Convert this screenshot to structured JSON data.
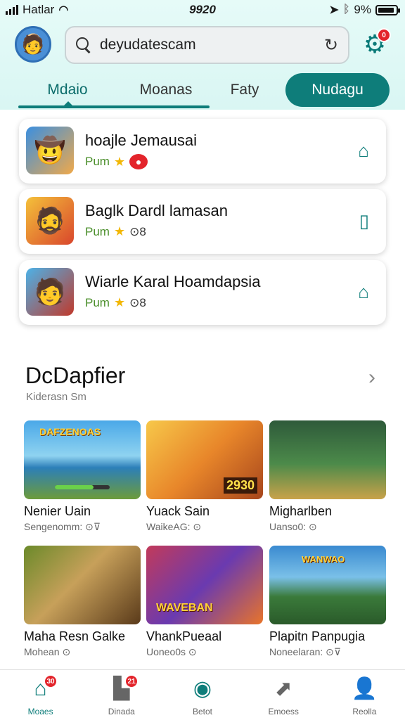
{
  "status_bar": {
    "carrier": "Hatlar",
    "time": "9920",
    "battery": "9%",
    "battery_level": 0.9
  },
  "search": {
    "value": "deyudatescam"
  },
  "settings": {
    "badge": "0"
  },
  "tabs": [
    {
      "label": "Mdaio"
    },
    {
      "label": "Moanas"
    },
    {
      "label": "Faty"
    },
    {
      "label": "Nudagu"
    }
  ],
  "featured": [
    {
      "title": "hoajle Jemausai",
      "meta": "Pum"
    },
    {
      "title": "Baglk Dardl lamasan",
      "meta": "Pum",
      "extra": "⊙8"
    },
    {
      "title": "Wiarle Karal Hoamdapsia",
      "meta": "Pum",
      "extra": "⊙8"
    }
  ],
  "section": {
    "title": "DcDapfier",
    "subtitle": "Kiderasn Sm"
  },
  "games": [
    {
      "name": "Nenier Uain",
      "dev": "Sengenomm: ⊙⊽",
      "banner": "DAFZENOAS"
    },
    {
      "name": "Yuack Sain",
      "dev": "WaikeAG: ⊙",
      "banner": "2930"
    },
    {
      "name": "Migharlben",
      "dev": "Uanso0: ⊙",
      "banner": ""
    },
    {
      "name": "Maha Resn Galke",
      "dev": "Mohean ⊙",
      "banner": ""
    },
    {
      "name": "VhankPueaal",
      "dev": "Uoneo0s ⊙",
      "banner": "WAVEBAN"
    },
    {
      "name": "Plapitn Panpugia",
      "dev": "Noneelaran: ⊙⊽",
      "banner": "WANWAO"
    }
  ],
  "nav": [
    {
      "label": "Moaes",
      "badge": "30"
    },
    {
      "label": "Dinada",
      "badge": "21"
    },
    {
      "label": "Betot"
    },
    {
      "label": "Emoess"
    },
    {
      "label": "Reolla"
    }
  ],
  "colors": {
    "accent": "#0e7d7a",
    "badge": "#e3242b"
  }
}
